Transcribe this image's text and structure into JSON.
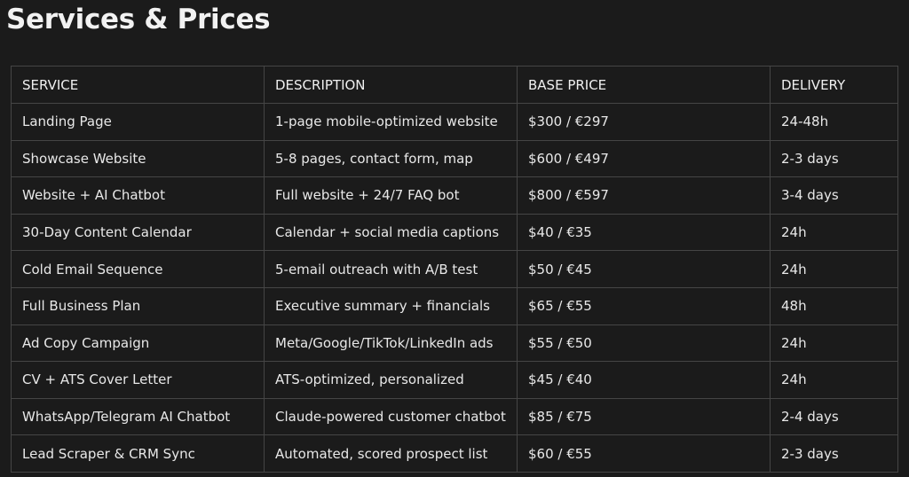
{
  "page": {
    "title": "Services & Prices"
  },
  "table": {
    "headers": [
      "SERVICE",
      "DESCRIPTION",
      "BASE PRICE",
      "DELIVERY"
    ],
    "rows": [
      [
        "Landing Page",
        "1-page mobile-optimized website",
        "$300 / €297",
        "24-48h"
      ],
      [
        "Showcase Website",
        "5-8 pages, contact form, map",
        "$600 / €497",
        "2-3 days"
      ],
      [
        "Website + AI Chatbot",
        "Full website + 24/7 FAQ bot",
        "$800 / €597",
        "3-4 days"
      ],
      [
        "30-Day Content Calendar",
        "Calendar + social media captions",
        "$40 / €35",
        "24h"
      ],
      [
        "Cold Email Sequence",
        "5-email outreach with A/B test",
        "$50 / €45",
        "24h"
      ],
      [
        "Full Business Plan",
        "Executive summary + financials",
        "$65 / €55",
        "48h"
      ],
      [
        "Ad Copy Campaign",
        "Meta/Google/TikTok/LinkedIn ads",
        "$55 / €50",
        "24h"
      ],
      [
        "CV + ATS Cover Letter",
        "ATS-optimized, personalized",
        "$45 / €40",
        "24h"
      ],
      [
        "WhatsApp/Telegram AI Chatbot",
        "Claude-powered customer chatbot",
        "$85 / €75",
        "2-4 days"
      ],
      [
        "Lead Scraper & CRM Sync",
        "Automated, scored prospect list",
        "$60 / €55",
        "2-3 days"
      ]
    ]
  }
}
